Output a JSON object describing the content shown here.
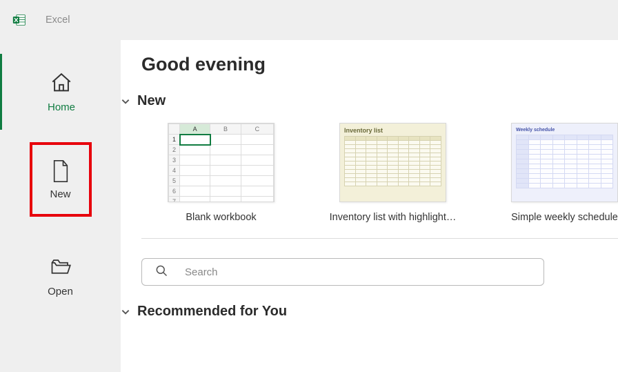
{
  "app": {
    "title": "Excel"
  },
  "sidebar": {
    "home": "Home",
    "new": "New",
    "open": "Open"
  },
  "main": {
    "greeting": "Good evening",
    "sections": {
      "new_label": "New",
      "recommended_label": "Recommended for You"
    },
    "templates": [
      {
        "name": "Blank workbook"
      },
      {
        "name": "Inventory list with highlight…",
        "thumb_title": "Inventory list"
      },
      {
        "name": "Simple weekly schedule",
        "thumb_title": "Weekly schedule"
      }
    ],
    "search": {
      "placeholder": "Search"
    }
  },
  "colors": {
    "accent": "#107c41",
    "highlight": "#e7000b"
  }
}
